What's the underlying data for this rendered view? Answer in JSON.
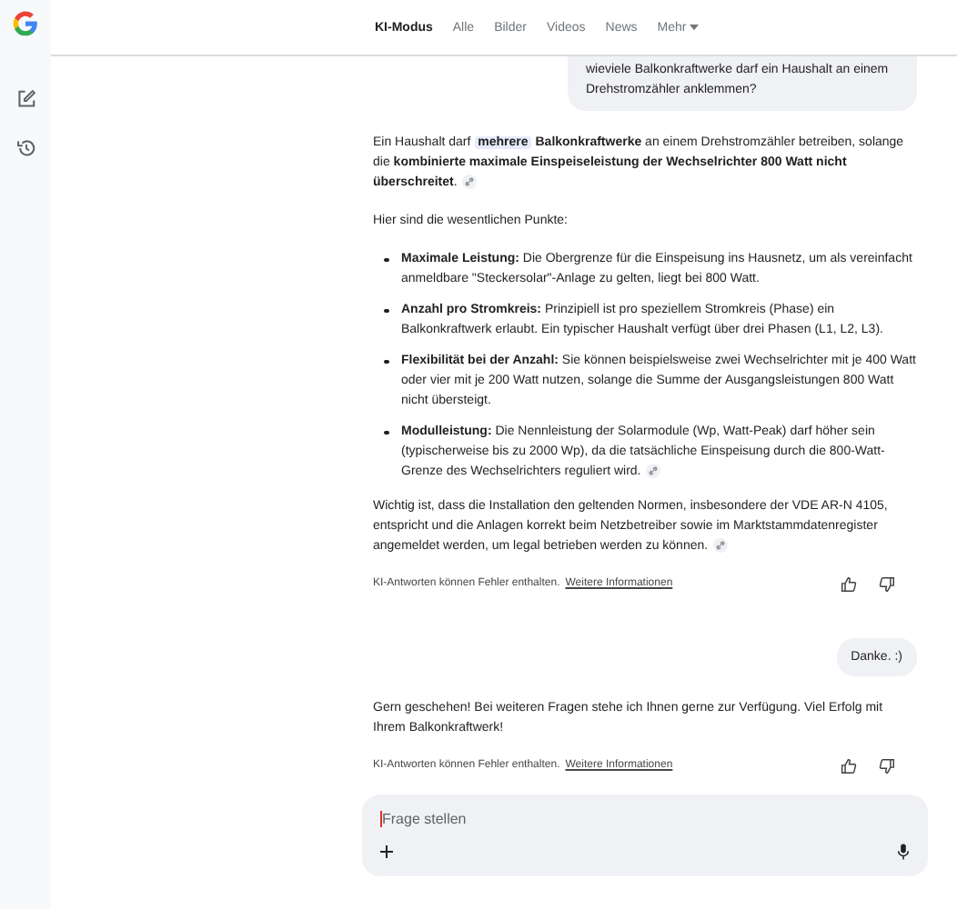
{
  "tabs": [
    {
      "label": "KI-Modus",
      "selected": true,
      "kind": "tab"
    },
    {
      "label": "Alle",
      "selected": false,
      "kind": "tab"
    },
    {
      "label": "Bilder",
      "selected": false,
      "kind": "tab"
    },
    {
      "label": "Videos",
      "selected": false,
      "kind": "tab"
    },
    {
      "label": "News",
      "selected": false,
      "kind": "tab"
    },
    {
      "label": "Mehr",
      "selected": false,
      "kind": "menu"
    }
  ],
  "messages": [
    {
      "kind": "user",
      "text": "wieviele Balkonkraftwerke darf ein Haushalt an einem Drehstromzähler anklemmen?"
    },
    {
      "kind": "answer",
      "blocks": [
        {
          "kind": "paragraph",
          "source": true,
          "parts": [
            {
              "text": "Ein Haushalt darf "
            },
            {
              "text": "**mehrere**",
              "highlighted": true
            },
            {
              "text": " **Balkonkraftwerke** an einem Drehstromzähler betreiben, solange die **kombinierte maximale Einspeiseleistung der Wechselrichter 800 Watt nicht überschreitet**."
            }
          ]
        },
        {
          "kind": "paragraph",
          "source": false,
          "parts": [
            {
              "text": "Hier sind die wesentlichen Punkte:"
            }
          ]
        },
        {
          "kind": "list",
          "items": [
            {
              "text": "**Maximale Leistung:** Die Obergrenze für die Einspeisung ins Hausnetz, um als vereinfacht anmeldbare \"Steckersolar\"-Anlage zu gelten, liegt bei 800 Watt.",
              "source": false
            },
            {
              "text": "**Anzahl pro Stromkreis:** Prinzipiell ist pro speziellem Stromkreis (Phase) ein Balkonkraftwerk erlaubt. Ein typischer Haushalt verfügt über drei Phasen (L1, L2, L3).",
              "source": false
            },
            {
              "text": "**Flexibilität bei der Anzahl:** Sie können beispielsweise zwei Wechselrichter mit je 400 Watt oder vier mit je 200 Watt nutzen, solange die Summe der Ausgangsleistungen 800 Watt nicht übersteigt.",
              "source": false
            },
            {
              "text": "**Modulleistung:** Die Nennleistung der Solarmodule (Wp, Watt-Peak) darf höher sein (typischerweise bis zu 2000 Wp), da die tatsächliche Einspeisung durch die 800-Watt-Grenze des Wechselrichters reguliert wird.",
              "source": true
            }
          ]
        },
        {
          "kind": "paragraph",
          "source": true,
          "parts": [
            {
              "text": "Wichtig ist, dass die Installation den geltenden Normen, insbesondere der VDE AR-N 4105, entspricht und die Anlagen korrekt beim Netzbetreiber sowie im Marktstammdatenregister angemeldet werden, um legal betrieben werden zu können."
            }
          ]
        }
      ],
      "footer": {
        "text": "KI-Antworten können Fehler enthalten.",
        "link": "Weitere Informationen"
      }
    },
    {
      "kind": "user",
      "text": "Danke. :)"
    },
    {
      "kind": "answer",
      "blocks": [
        {
          "kind": "paragraph",
          "source": false,
          "parts": [
            {
              "text": "Gern geschehen! Bei weiteren Fragen stehe ich Ihnen gerne zur Verfügung. Viel Erfolg mit Ihrem Balkonkraftwerk!"
            }
          ]
        }
      ],
      "footer": {
        "text": "KI-Antworten können Fehler enthalten.",
        "link": "Weitere Informationen"
      }
    }
  ],
  "input": {
    "placeholder": "Frage stellen"
  }
}
